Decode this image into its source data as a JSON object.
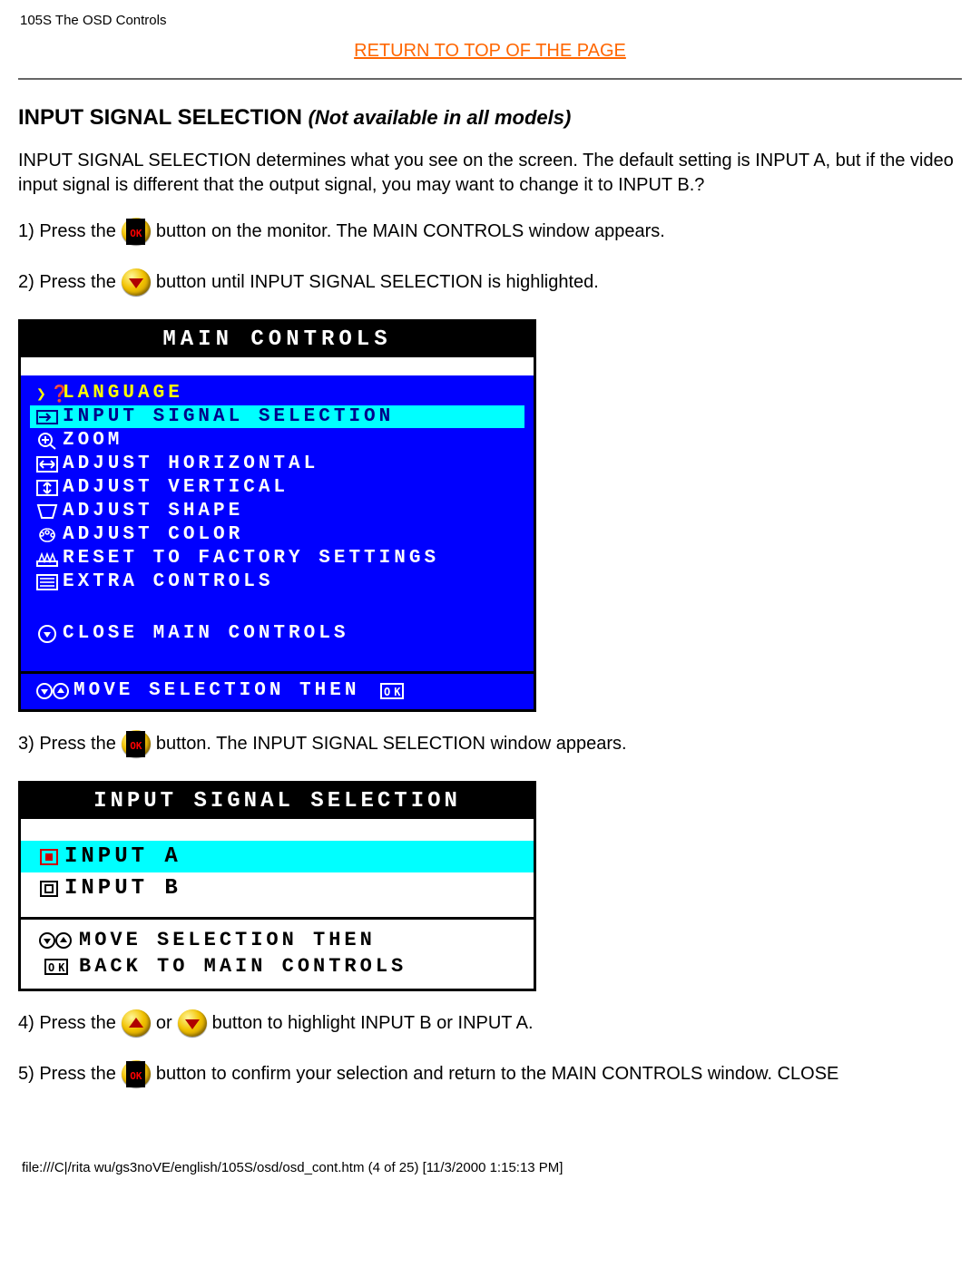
{
  "header": "105S The OSD Controls",
  "top_link": "RETURN TO TOP OF THE PAGE",
  "section": {
    "title": "INPUT SIGNAL SELECTION",
    "note": "(Not available in all models)"
  },
  "intro": "INPUT SIGNAL SELECTION determines what you see on the screen. The default setting is INPUT A, but if the video input signal is different that the output signal, you may want to change it to INPUT B.?",
  "steps": {
    "s1a": "1) Press the",
    "s1b": "button on the monitor. The MAIN CONTROLS window appears.",
    "s2a": "2) Press the",
    "s2b": "button until INPUT SIGNAL SELECTION is highlighted.",
    "s3a": "3) Press the",
    "s3b": "button. The INPUT SIGNAL SELECTION window appears.",
    "s4a": "4) Press the",
    "s4b": "or",
    "s4c": " button to highlight INPUT B or INPUT A.",
    "s5a": "5) Press the",
    "s5b": "button to confirm your selection and return to the MAIN CONTROLS window. CLOSE"
  },
  "osd_main": {
    "title": "MAIN CONTROLS",
    "items": [
      "LANGUAGE",
      "INPUT SIGNAL SELECTION",
      "ZOOM",
      "ADJUST HORIZONTAL",
      "ADJUST VERTICAL",
      "ADJUST SHAPE",
      "ADJUST COLOR",
      "RESET TO FACTORY SETTINGS",
      "EXTRA CONTROLS"
    ],
    "close": "CLOSE MAIN CONTROLS",
    "footer": "MOVE SELECTION THEN"
  },
  "osd_input": {
    "title": "INPUT SIGNAL SELECTION",
    "a": "INPUT A",
    "b": "INPUT B",
    "f1": "MOVE SELECTION THEN",
    "f2": "BACK TO MAIN CONTROLS"
  },
  "footer_path": "file:///C|/rita wu/gs3noVE/english/105S/osd/osd_cont.htm (4 of 25) [11/3/2000 1:15:13 PM]"
}
